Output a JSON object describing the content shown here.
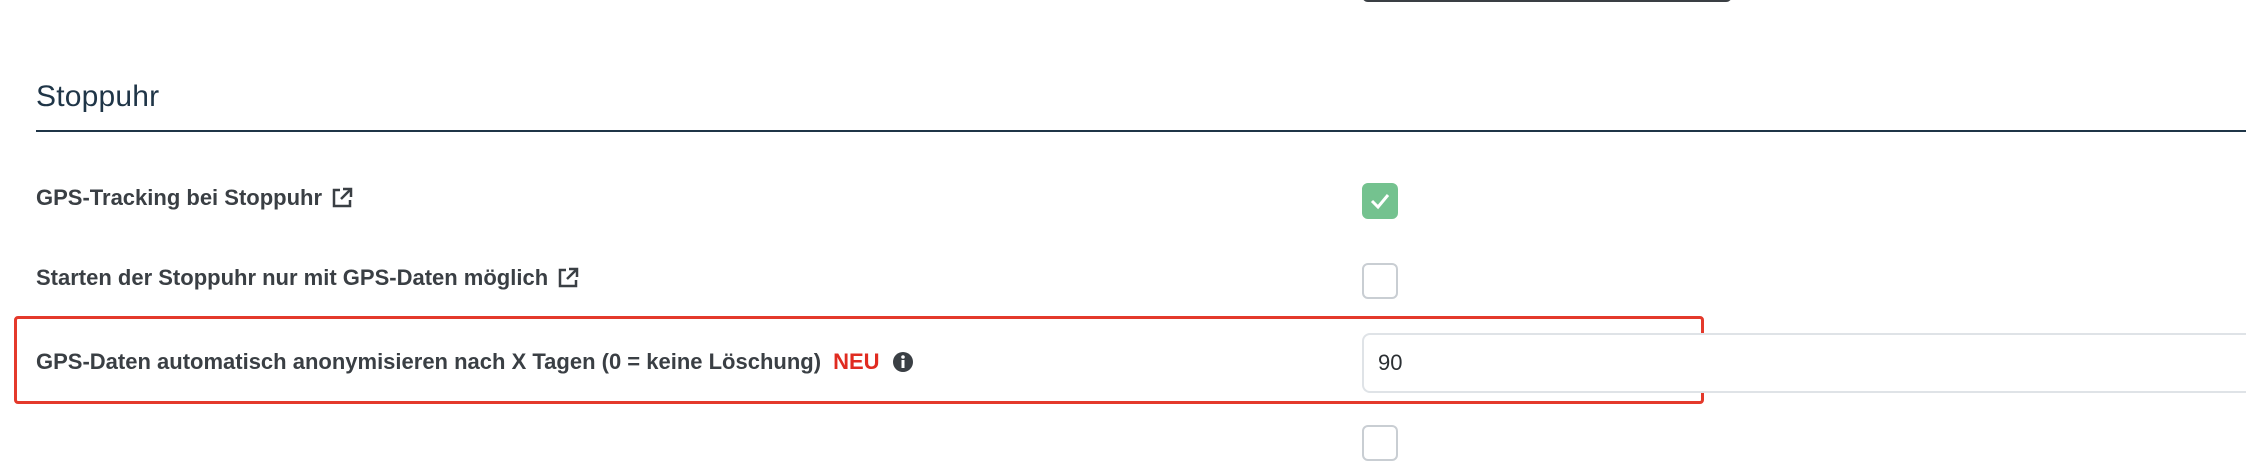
{
  "section": {
    "title": "Stoppuhr"
  },
  "rows": [
    {
      "label": "GPS-Tracking bei Stoppuhr",
      "icon": "external-link-icon",
      "control": "checkbox",
      "checked": true
    },
    {
      "label": "Starten der Stoppuhr nur mit GPS-Daten möglich",
      "icon": "external-link-icon",
      "control": "checkbox",
      "checked": false
    },
    {
      "label": "GPS-Daten automatisch anonymisieren nach X Tagen (0 = keine Löschung)",
      "badge": "NEU",
      "icon": "info-icon",
      "control": "text-input",
      "value": "90"
    },
    {
      "label": "",
      "control": "checkbox",
      "checked": false
    }
  ],
  "colors": {
    "section_title": "#1f3547",
    "checkbox_checked": "#74c28f",
    "highlight": "#e4392b",
    "badge_new": "#e02b20"
  }
}
